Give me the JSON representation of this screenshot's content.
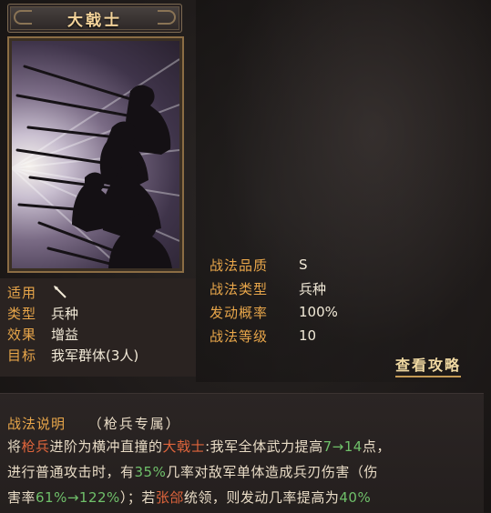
{
  "title": "大戟士",
  "card": {
    "icon": "silhouette-infantry-art"
  },
  "left_info": {
    "apply_label": "适用",
    "apply_icon": "spear-icon",
    "type_label": "类型",
    "type_value": "兵种",
    "effect_label": "效果",
    "effect_value": "增益",
    "target_label": "目标",
    "target_value": "我军群体(3人)"
  },
  "stats": {
    "quality_label": "战法品质",
    "quality_value": "S",
    "category_label": "战法类型",
    "category_value": "兵种",
    "trigger_label": "发动概率",
    "trigger_value": "100%",
    "level_label": "战法等级",
    "level_value": "10"
  },
  "guide_link": "查看攻略",
  "description": {
    "header_title": "战法说明",
    "header_sub": "（枪兵专属）",
    "line1": {
      "p1": "将",
      "p2": "枪兵",
      "p3": "进阶为横冲直撞的",
      "p4": "大戟士",
      "p5": ":我军全体武力提高",
      "p6": "7→14",
      "p7": "点，"
    },
    "line2": {
      "p1": "进行普通攻击时，有",
      "p2": "35%",
      "p3": "几率对敌军单体造成兵刃伤害（伤"
    },
    "line3": {
      "p1": "害率",
      "p2": "61%→122%",
      "p3": "）；若",
      "p4": "张郃",
      "p5": "统领，则发动几率提高为",
      "p6": "40%"
    }
  },
  "colors": {
    "label": "#e8a64a",
    "value": "#f2ead8",
    "highlight_red": "#e0653c",
    "highlight_green": "#6fc06a",
    "frame": "#8b6d44"
  }
}
